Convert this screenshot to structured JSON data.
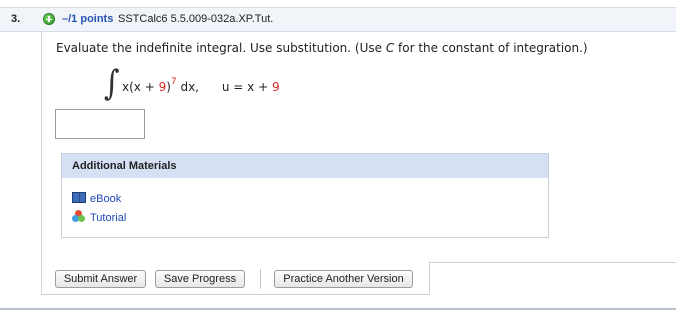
{
  "question": {
    "number": "3.",
    "points": "–/1 points",
    "id": "SSTCalc6 5.5.009-032a.XP.Tut."
  },
  "prompt": {
    "before": "Evaluate the indefinite integral. Use substitution. (Use ",
    "var": "C",
    "after": " for the constant of integration.)"
  },
  "expression": {
    "integral": "∫",
    "a": "x(x + ",
    "b": "9",
    "c": ")",
    "exp": "7",
    "d": " dx,",
    "sub_lhs": "u = x + ",
    "sub_rhs": "9"
  },
  "answer": {
    "value": ""
  },
  "materials": {
    "title": "Additional Materials",
    "items": [
      {
        "label": "eBook",
        "icon": "ebook-icon"
      },
      {
        "label": "Tutorial",
        "icon": "tutorial-icon"
      }
    ]
  },
  "buttons": {
    "submit": "Submit Answer",
    "save": "Save Progress",
    "practice": "Practice Another Version"
  },
  "colors": {
    "accent_blue": "#2855b5",
    "header_bg": "#f1f4f8",
    "materials_head_bg": "#d5e0f5",
    "highlight_red": "#d42a1d",
    "link_blue": "#1f47b5"
  }
}
